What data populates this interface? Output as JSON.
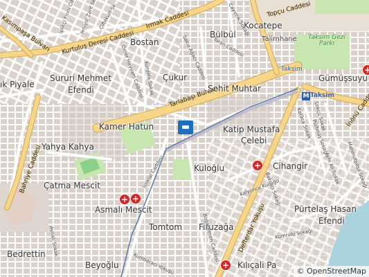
{
  "map": {
    "attribution": "© OpenStreetMap",
    "colors": {
      "primary_road": "#f7d58a",
      "road_casing": "#d4a84a",
      "residential": "#ffffff",
      "block": "#d9d0c9",
      "park": "#c8e6b0",
      "water": "#aad3df",
      "metro_line": "#5577aa",
      "hospital": "#dd2222",
      "hotel": "#1a6fbf"
    },
    "areas": {
      "bulbul": "Bülbül",
      "kocatepe": "Kocatepe",
      "talimhane": "Talimhane",
      "bostan": "Bostan",
      "cukur": "Çukur",
      "sehit_muhtar": "Şehit Muhtar",
      "kocatepe_pre": "",
      "piyale": "ık Piyale",
      "sururi": "Sururi Mehmet",
      "efendi1": "Efendi",
      "kamer_hatun": "Kamer Hatun",
      "katip": "Katip Mustafa",
      "celebi": "Çelebi",
      "yahya": "Yahya Kahya",
      "kuloglu": "Kuloğlu",
      "cihangir": "Cihangir",
      "catma": "Çatma Mescit",
      "asmali": "Asmalı Mescit",
      "purtelas": "Pürtelaş Hasan",
      "efendi2": "Efendi",
      "tomtom": "Tomtom",
      "firuzaga": "Firuzağa",
      "bedrettin": "Bedrettin",
      "beyoglu": "Beyoğlu",
      "kilicali": "Kılıçali Pa",
      "gumussuyu": "Gümüşsuyu"
    },
    "roads": {
      "irmak": "Irmak Caddesi",
      "kurtulus": "Kurtuluş Deresi Caddesi",
      "kasimpasa": "Kasımpaşa Bulvarı",
      "tarlabasi": "Tarlabaşı Bulvarı",
      "topcu": "Topçu Caddesi",
      "defterdar": "Defterdar Yokuşu",
      "inonu": "İnönü Caddesi",
      "bahriye": "Bahriye Caddesi",
      "bogazkesen": "Boğazkesen Caddesi",
      "istiklal": "İstiklal Caddesi",
      "siraselviler": "Sıraselviler"
    },
    "streets": {
      "iplikci": "İplikçi Fırını Cd.",
      "yenioyol": "Yeniyol Zarif Sk.",
      "ciftekurt": "Çiftekurt Sk.",
      "cayiracik": "Cayırcık Sokağı",
      "turan": "Turan Caddesi",
      "omer": "Ömer Hayyam Caddesi",
      "kurdela": "Kurdela Sokak",
      "sakiz": "Sakız Ağacı Caddesi",
      "kalyoncu": "Kalyoncu Kulluğu",
      "bakraci": "Bakracı Sokağı",
      "kumrulu": "Kumrulu Sokağı",
      "kumbaraci": "Kumbaracı Yokuşu",
      "ayni": "Aynalı Sokak",
      "karaca": "Karaca Sokak",
      "purtelas_sk": "Pürtelaş Sokağı",
      "mahmut": "Mahmutpaşa Sokağı",
      "ayni_ali": "Ayni Ali Sokak",
      "lokcu": "Lokçu Sokak"
    },
    "poi": {
      "taksim_metro": "Taksim",
      "taksim_square": "Taksim",
      "taksim_gezi": "Taksim Gezi Parkı"
    },
    "icons": {
      "hospital": "hospital-cross-icon",
      "hotel": "bed-icon",
      "metro": "metro-m-icon"
    }
  }
}
